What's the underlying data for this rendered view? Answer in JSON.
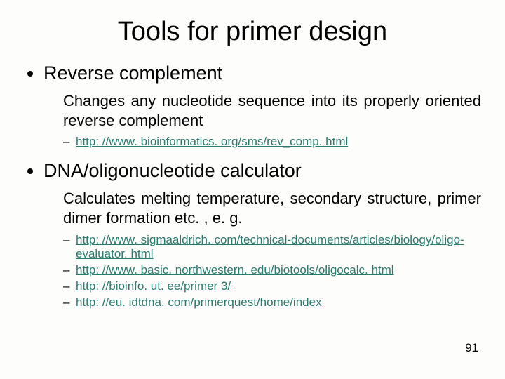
{
  "title": "Tools for primer design",
  "sections": [
    {
      "heading": "Reverse complement",
      "desc": "Changes any nucleotide sequence into its properly oriented reverse complement",
      "justify": true,
      "links": [
        "http: //www. bioinformatics. org/sms/rev_comp. html"
      ]
    },
    {
      "heading": "DNA/oligonucleotide calculator",
      "desc": "Calculates melting temperature, secondary structure, primer dimer formation etc. , e. g.",
      "justify": true,
      "links": [
        "http: //www. sigmaaldrich. com/technical-documents/articles/biology/oligo-evaluator. html",
        "http: //www. basic. northwestern. edu/biotools/oligocalc. html",
        "http: //bioinfo. ut. ee/primer 3/",
        "http: //eu. idtdna. com/primerquest/home/index"
      ]
    }
  ],
  "page_number": "91"
}
